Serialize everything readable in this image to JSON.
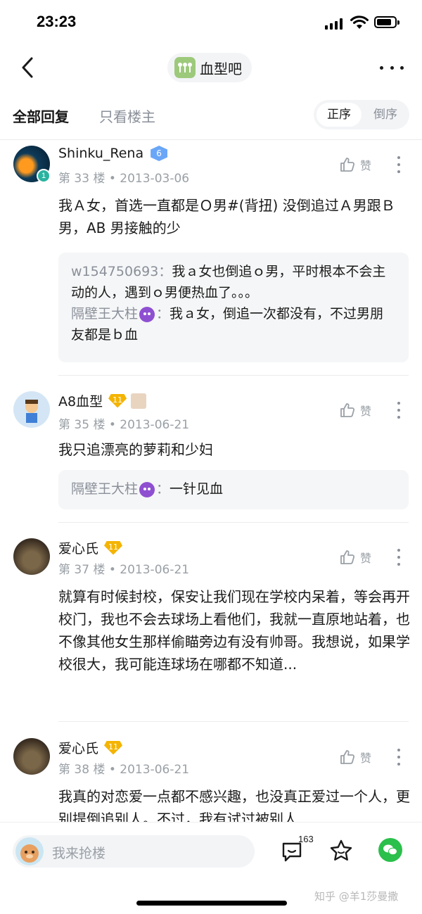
{
  "status_bar": {
    "time": "23:23"
  },
  "nav": {
    "forum_name": "血型吧"
  },
  "tabs": {
    "all_replies": "全部回复",
    "op_only": "只看楼主",
    "order_asc": "正序",
    "order_desc": "倒序"
  },
  "posts": [
    {
      "username": "Shinku_Rena",
      "badge": "6",
      "floor": "第 33 楼",
      "date": "• 2013-03-06",
      "like_label": "赞",
      "content": "我Ａ女，首选一直都是Ｏ男#(背扭) 没倒追过Ａ男跟Ｂ男，AB 男接触的少",
      "replies": [
        {
          "name": "w154750693",
          "sep": "：",
          "text": "我ａ女也倒追ｏ男，平时根本不会主动的人，遇到ｏ男便热血了。。。"
        },
        {
          "name": "隔壁王大柱",
          "sep": "：",
          "text": "我ａ女，倒追一次都没有，不过男朋友都是ｂ血"
        }
      ]
    },
    {
      "username": "A8血型",
      "badge": "11",
      "floor": "第 35 楼",
      "date": "• 2013-06-21",
      "like_label": "赞",
      "content": "我只追漂亮的萝莉和少妇",
      "replies": [
        {
          "name": "隔壁王大柱",
          "sep": "：",
          "text": "一针见血"
        }
      ]
    },
    {
      "username": "爱心氏",
      "badge": "11",
      "floor": "第 37 楼",
      "date": "• 2013-06-21",
      "like_label": "赞",
      "content": "就算有时候封校，保安让我们现在学校内呆着，等会再开校门，我也不会去球场上看他们，我就一直原地站着，也不像其他女生那样偷瞄旁边有没有帅哥。我想说，如果学校很大，我可能连球场在哪都不知道..."
    },
    {
      "username": "爱心氏",
      "badge": "11",
      "floor": "第 38 楼",
      "date": "• 2013-06-21",
      "like_label": "赞",
      "content": "我真的对恋爱一点都不感兴趣，也没真正爱过一个人，更别提倒追别人。不过，我有试过被别人"
    }
  ],
  "bottom_bar": {
    "reply_placeholder": "我来抢楼",
    "comment_count": "163"
  },
  "watermark": "知乎 @羊1莎曼撒"
}
